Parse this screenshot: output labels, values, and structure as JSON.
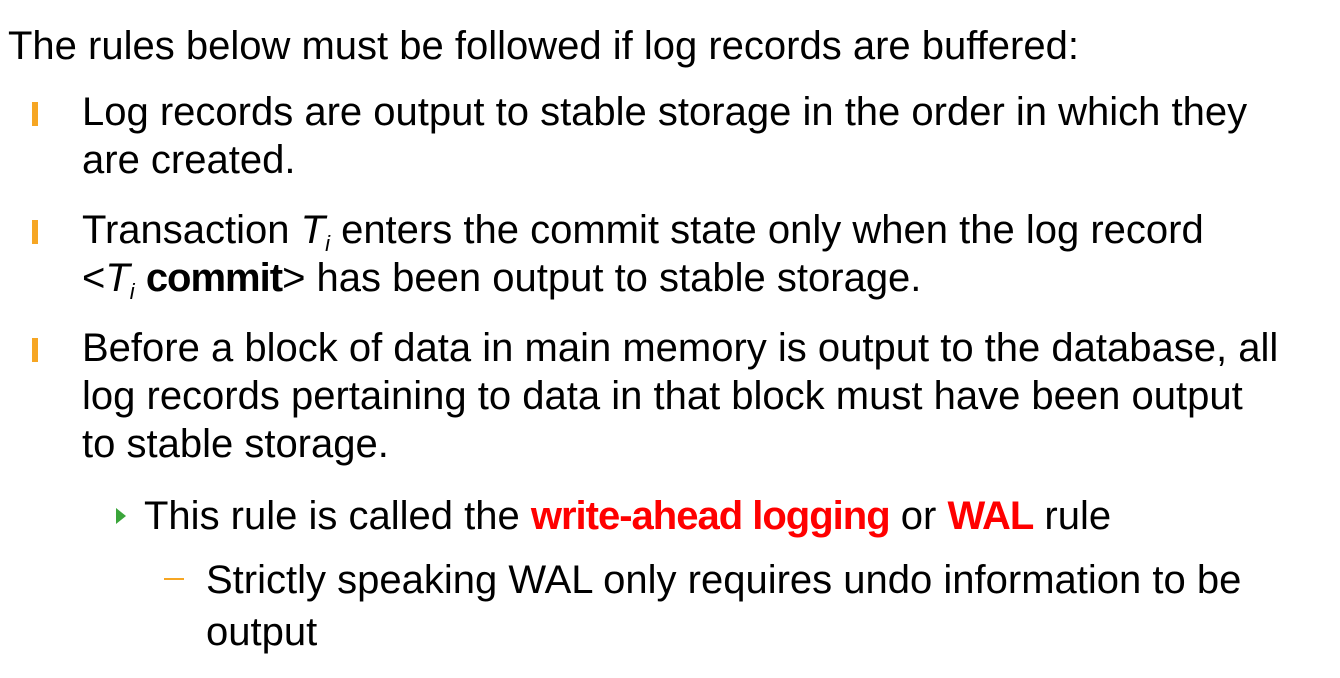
{
  "intro": {
    "text": "The rules below must be followed if log records are buffered:"
  },
  "bullets": [
    {
      "lines": [
        "Log records are output to stable storage in the order in which they",
        "are created."
      ]
    },
    {
      "line1": {
        "prefix": "Transaction ",
        "ti_main": "T",
        "ti_sub": "i",
        "suffix": " enters the commit state only when the log record"
      },
      "line2": {
        "open": "<",
        "ti_main": "T",
        "ti_sub": "i",
        "space": " ",
        "commit": "commit",
        "close": ">",
        "suffix": " has been output to stable storage."
      }
    },
    {
      "lines": [
        "Before a block of data in main memory is output to the database, all",
        "log records pertaining to data in that block must have been output",
        "to stable storage."
      ]
    }
  ],
  "sub_bullet": {
    "prefix": "This rule is called the ",
    "highlight1": "write-ahead logging",
    "middle": " or ",
    "highlight2": "WAL",
    "suffix": " rule"
  },
  "subsub_bullet": {
    "lines": [
      "Strictly speaking WAL only requires undo information to be",
      "output"
    ]
  },
  "colors": {
    "bullet": "#f6a623",
    "triangle": "#3aa53a",
    "highlight": "#ff0000",
    "text": "#000000"
  }
}
